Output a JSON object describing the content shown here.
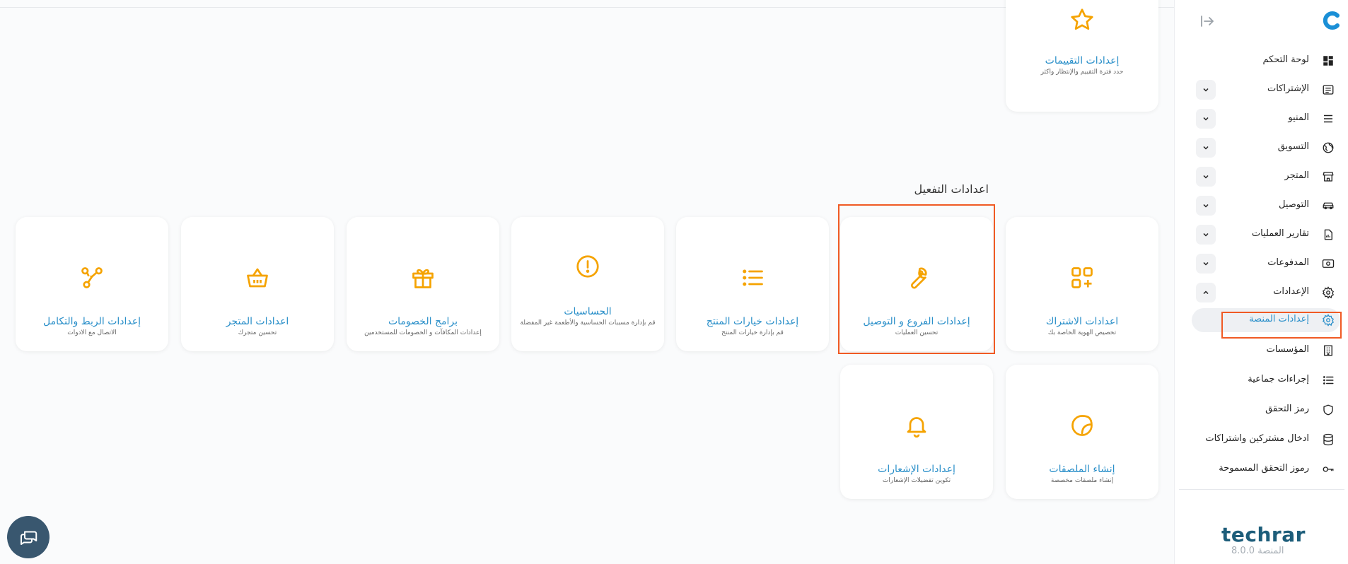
{
  "sidebar": {
    "items": [
      {
        "label": "لوحة التحكم"
      },
      {
        "label": "الإشتراكات"
      },
      {
        "label": "المنيو"
      },
      {
        "label": "التسويق"
      },
      {
        "label": "المتجر"
      },
      {
        "label": "التوصيل"
      },
      {
        "label": "تقارير العمليات"
      },
      {
        "label": "المدفوعات"
      },
      {
        "label": "الإعدادات"
      },
      {
        "label": "إعدادات المنصة"
      },
      {
        "label": "المؤسسات"
      },
      {
        "label": "إجراءات جماعية"
      },
      {
        "label": "رمز التحقق"
      },
      {
        "label": "ادخال مشتركين واشتراكات"
      },
      {
        "label": "رموز التحقق المسموحة"
      }
    ],
    "brand": "techrar",
    "version": "المنصة 8.0.0"
  },
  "main": {
    "ratings_card": {
      "title": "إعدادات التقييمات",
      "subtitle": "حدد فترة التقييم والإنتظار واكثر"
    },
    "section_title": "اعدادات التفعيل",
    "cards": [
      {
        "title": "اعدادات الاشتراك",
        "subtitle": "تخصيص الهوية الخاصة بك"
      },
      {
        "title": "إعدادات الفروع و التوصيل",
        "subtitle": "تحسين العمليات"
      },
      {
        "title": "إعدادات خيارات المنتج",
        "subtitle": "قم بإدارة خيارات المنتج"
      },
      {
        "title": "الحساسيات",
        "subtitle": "قم بإدارة مسببات الحساسية والأطعمة غير المفضلة"
      },
      {
        "title": "برامج الخصومات",
        "subtitle": "إعدادات المكافآت و الخصومات للمستخدمين"
      },
      {
        "title": "اعدادات المتجر",
        "subtitle": "تحسين متجرك"
      },
      {
        "title": "إعدادات الربط والتكامل",
        "subtitle": "الاتصال مع الادوات"
      },
      {
        "title": "إنشاء الملصقات",
        "subtitle": "إنشاء ملصقات مخصصة"
      },
      {
        "title": "إعدادات الإشعارات",
        "subtitle": "تكوين تفضيلات الإشعارات"
      }
    ]
  },
  "colors": {
    "accent": "#f5a300",
    "link": "#2a8fc9",
    "highlight": "#f05a24",
    "brand": "#1d5d7a"
  }
}
